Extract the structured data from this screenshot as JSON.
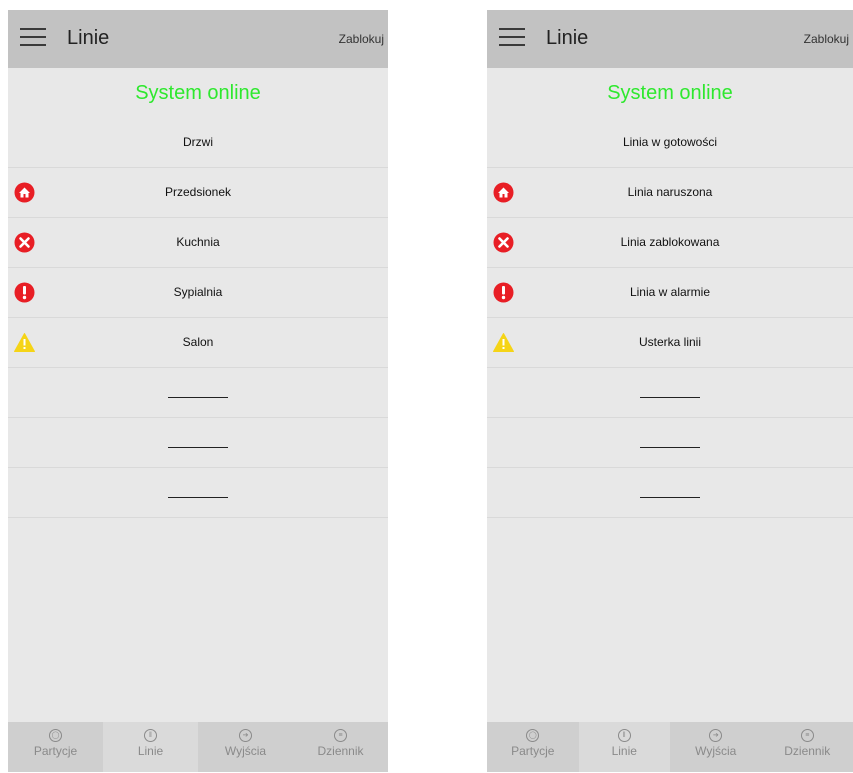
{
  "colors": {
    "header_bg": "#c2c2c2",
    "status_green": "#2ee82e",
    "danger_red": "#e81e25",
    "warning_yellow": "#f5d417"
  },
  "screens": [
    {
      "header": {
        "title": "Linie",
        "lock_label": "Zablokuj"
      },
      "status": "System online",
      "rows": [
        {
          "label": "Drzwi",
          "icon": ""
        },
        {
          "label": "Przedsionek",
          "icon": "home-alert-icon"
        },
        {
          "label": "Kuchnia",
          "icon": "blocked-x-icon"
        },
        {
          "label": "Sypialnia",
          "icon": "alarm-exclamation-icon"
        },
        {
          "label": "Salon",
          "icon": "warning-triangle-icon"
        },
        {
          "label": "",
          "icon": ""
        },
        {
          "label": "",
          "icon": ""
        },
        {
          "label": "",
          "icon": ""
        }
      ],
      "nav": [
        {
          "label": "Partycje",
          "icon": "partition-icon"
        },
        {
          "label": "Linie",
          "icon": "lines-icon"
        },
        {
          "label": "Wyjścia",
          "icon": "outputs-icon"
        },
        {
          "label": "Dziennik",
          "icon": "log-icon"
        }
      ]
    },
    {
      "header": {
        "title": "Linie",
        "lock_label": "Zablokuj"
      },
      "status": "System online",
      "rows": [
        {
          "label": "Linia w gotowości",
          "icon": ""
        },
        {
          "label": "Linia naruszona",
          "icon": "home-alert-icon"
        },
        {
          "label": "Linia zablokowana",
          "icon": "blocked-x-icon"
        },
        {
          "label": "Linia w alarmie",
          "icon": "alarm-exclamation-icon"
        },
        {
          "label": "Usterka linii",
          "icon": "warning-triangle-icon"
        },
        {
          "label": "",
          "icon": ""
        },
        {
          "label": "",
          "icon": ""
        },
        {
          "label": "",
          "icon": ""
        }
      ],
      "nav": [
        {
          "label": "Partycje",
          "icon": "partition-icon"
        },
        {
          "label": "Linie",
          "icon": "lines-icon"
        },
        {
          "label": "Wyjścia",
          "icon": "outputs-icon"
        },
        {
          "label": "Dziennik",
          "icon": "log-icon"
        }
      ]
    }
  ]
}
